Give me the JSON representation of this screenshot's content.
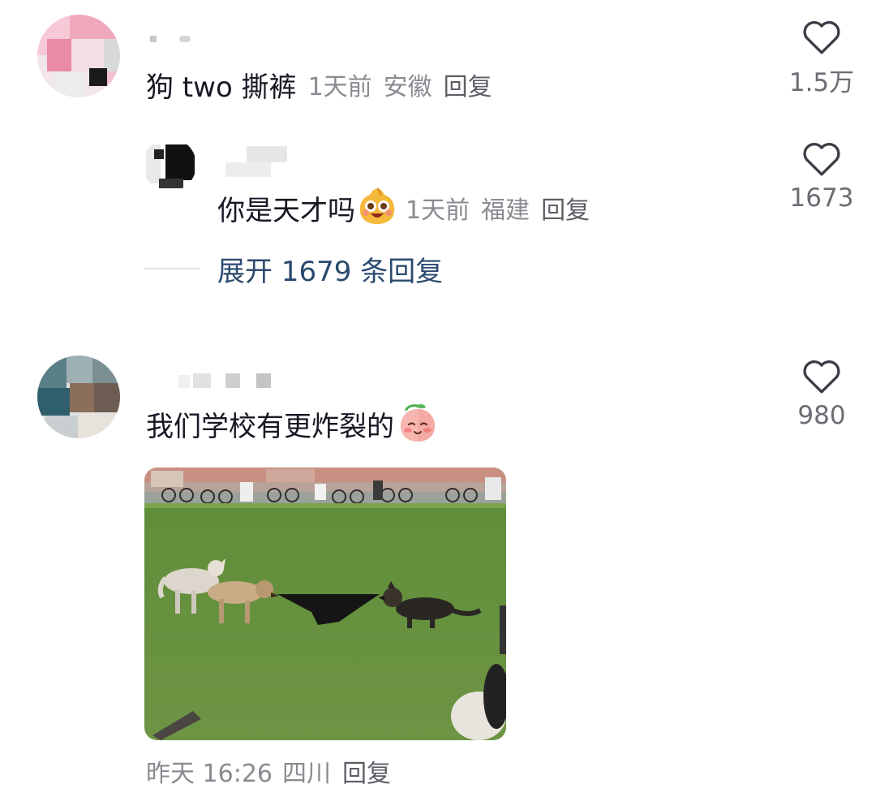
{
  "comments": [
    {
      "text": "狗 two 撕裤",
      "time": "1天前",
      "location": "安徽",
      "reply_label": "回复",
      "likes": "1.5万",
      "icon": "heart-outline-icon",
      "replies": [
        {
          "text": "你是天才吗",
          "emoji": "excited-face-emoji",
          "time": "1天前",
          "location": "福建",
          "reply_label": "回复",
          "likes": "1673",
          "icon": "heart-outline-icon"
        }
      ],
      "expand_label": "展开 1679 条回复"
    },
    {
      "text": "我们学校有更炸裂的",
      "emoji": "shy-peach-emoji",
      "likes": "980",
      "icon": "heart-outline-icon",
      "image": "dogs-tug-of-war-photo",
      "time": "昨天 16:26",
      "location": "四川",
      "reply_label": "回复"
    }
  ],
  "colors": {
    "text": "#161823",
    "meta": "#8a8b91",
    "link": "#2b4a6f",
    "grass": "#6f9a45"
  }
}
